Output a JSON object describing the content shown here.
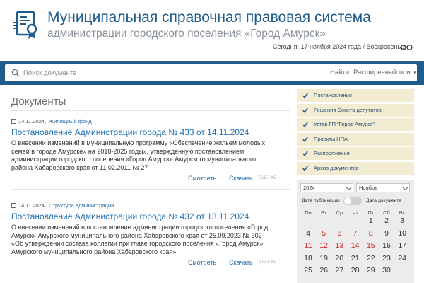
{
  "header": {
    "title": "Муниципальная справочная правовая система",
    "subtitle": "администрации городского поселения «Город Амурск»",
    "today": "Сегодня: 17 ноября 2024 года / Воскресенье",
    "logo_icon": "document-seal-icon",
    "accessibility_icon": "glasses-icon"
  },
  "search": {
    "placeholder": "Поиск документа",
    "find_label": "Найти",
    "advanced_label": "Расширенный поиск"
  },
  "main": {
    "section_title": "Документы",
    "documents": [
      {
        "date": "14.11.2024,",
        "category": "Жилищный фонд",
        "title": "Постановление Администрации города № 433 от 14.11.2024",
        "desc_lines": [
          "О внесении изменений в муниципальную программу «Обеспечение жильем молодых",
          "семей в городе Амурске» на 2018-2025 годы», утвержденную постановлением",
          "администрации городского поселения «Город Амурск» Амурского муниципального",
          "района Хабаровского края от 11.02.2011 № 27"
        ],
        "view_label": "Смотреть",
        "download_label": "Скачать",
        "size": "( 715.7 КБ )"
      },
      {
        "date": "14.11.2024,",
        "category": "Структура администрации",
        "title": "Постановление Администрации города № 432 от 13.11.2024",
        "desc_lines": [
          "О внесении изменений в постановление администрации городского поселения «Город",
          "Амурск» Амурского муниципального района Хабаровского края от 25.09.2023 № 302",
          "«Об утверждении состава коллегии при главе городского поселения «Город Амурск»",
          "Амурского муниципального района Хабаровского края»"
        ],
        "view_label": "Смотреть",
        "download_label": "Скачать",
        "size": "( 312.6 КБ )"
      }
    ]
  },
  "sidebar": {
    "items": [
      {
        "label": "Постановления"
      },
      {
        "label": "Решения Совета депутатов"
      },
      {
        "label": "Устав ГП \"Город Амурск\""
      },
      {
        "label": "Проекты НПА"
      },
      {
        "label": "Распоряжения"
      },
      {
        "label": "Архив документов"
      }
    ],
    "accent_color": "#1f5c8b",
    "item_bg": "#f2ecd3"
  },
  "calendar": {
    "year": "2024",
    "month": "Ноябрь",
    "toggle_left": "Дата публикации",
    "toggle_right": "Дата документа",
    "weekdays": [
      "Пн",
      "Вт",
      "Ср",
      "Чт",
      "Пт",
      "Сб",
      "Вс"
    ],
    "weeks": [
      [
        "",
        "",
        "",
        "",
        "1",
        "2",
        "3"
      ],
      [
        "4",
        "5",
        "6",
        "7",
        "8",
        "9",
        "10"
      ],
      [
        "11",
        "12",
        "13",
        "14",
        "15",
        "16",
        "17"
      ],
      [
        "18",
        "19",
        "20",
        "21",
        "22",
        "23",
        "24"
      ],
      [
        "25",
        "26",
        "27",
        "28",
        "29",
        "30",
        ""
      ]
    ],
    "highlighted_days": [
      "5",
      "6",
      "7",
      "8",
      "11",
      "12",
      "13",
      "14",
      "15"
    ],
    "highlight_color": "#cc1f1f"
  }
}
